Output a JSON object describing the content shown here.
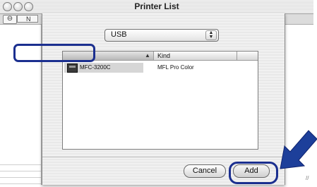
{
  "window": {
    "title": "Printer List"
  },
  "toolbar": {
    "column_button": "N"
  },
  "sheet": {
    "connection_popup": {
      "selected": "USB"
    },
    "table": {
      "columns": [
        "",
        "Kind"
      ],
      "rows": [
        {
          "name": "MFC-3200C",
          "kind": "MFL Pro Color"
        }
      ]
    },
    "buttons": {
      "cancel": "Cancel",
      "add": "Add"
    }
  },
  "colors": {
    "highlight": "#1b2f8f",
    "arrow": "#1d3f9a"
  },
  "icons": [
    "close-icon",
    "minimize-icon",
    "zoom-icon",
    "printer-icon",
    "sort-arrow-icon",
    "popup-arrows-icon",
    "pointer-arrow",
    "resize-grip-icon"
  ]
}
